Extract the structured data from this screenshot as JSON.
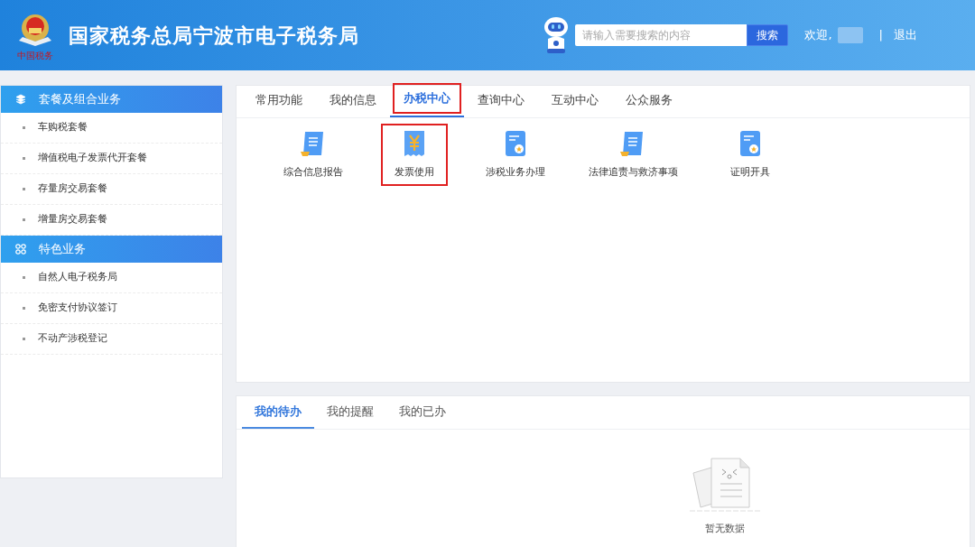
{
  "header": {
    "logo_text": "中国税务",
    "title": "国家税务总局宁波市电子税务局",
    "search": {
      "placeholder": "请输入需要搜索的内容",
      "button": "搜索"
    },
    "welcome": "欢迎,",
    "separator": "|",
    "logout": "退出"
  },
  "sidebar": [
    {
      "title": "套餐及组合业务",
      "kind": "layers",
      "items": [
        "车购税套餐",
        "增值税电子发票代开套餐",
        "存量房交易套餐",
        "增量房交易套餐"
      ]
    },
    {
      "title": "特色业务",
      "kind": "grid",
      "items": [
        "自然人电子税务局",
        "免密支付协议签订",
        "不动产涉税登记"
      ]
    }
  ],
  "main_tabs": [
    {
      "label": "常用功能",
      "selected": false,
      "highlighted": false
    },
    {
      "label": "我的信息",
      "selected": false,
      "highlighted": false
    },
    {
      "label": "办税中心",
      "selected": true,
      "highlighted": true
    },
    {
      "label": "查询中心",
      "selected": false,
      "highlighted": false
    },
    {
      "label": "互动中心",
      "selected": false,
      "highlighted": false
    },
    {
      "label": "公众服务",
      "selected": false,
      "highlighted": false
    }
  ],
  "functions": [
    {
      "label": "综合信息报告",
      "kind": "scroll",
      "highlighted": false
    },
    {
      "label": "发票使用",
      "kind": "invoice",
      "highlighted": true
    },
    {
      "label": "涉税业务办理",
      "kind": "certificate",
      "highlighted": false
    },
    {
      "label": "法律追责与救济事项",
      "kind": "scroll",
      "highlighted": false
    },
    {
      "label": "证明开具",
      "kind": "certificate",
      "highlighted": false
    }
  ],
  "task_tabs": [
    {
      "label": "我的待办",
      "selected": true
    },
    {
      "label": "我的提醒",
      "selected": false
    },
    {
      "label": "我的已办",
      "selected": false
    }
  ],
  "empty_text": "暂无数据"
}
